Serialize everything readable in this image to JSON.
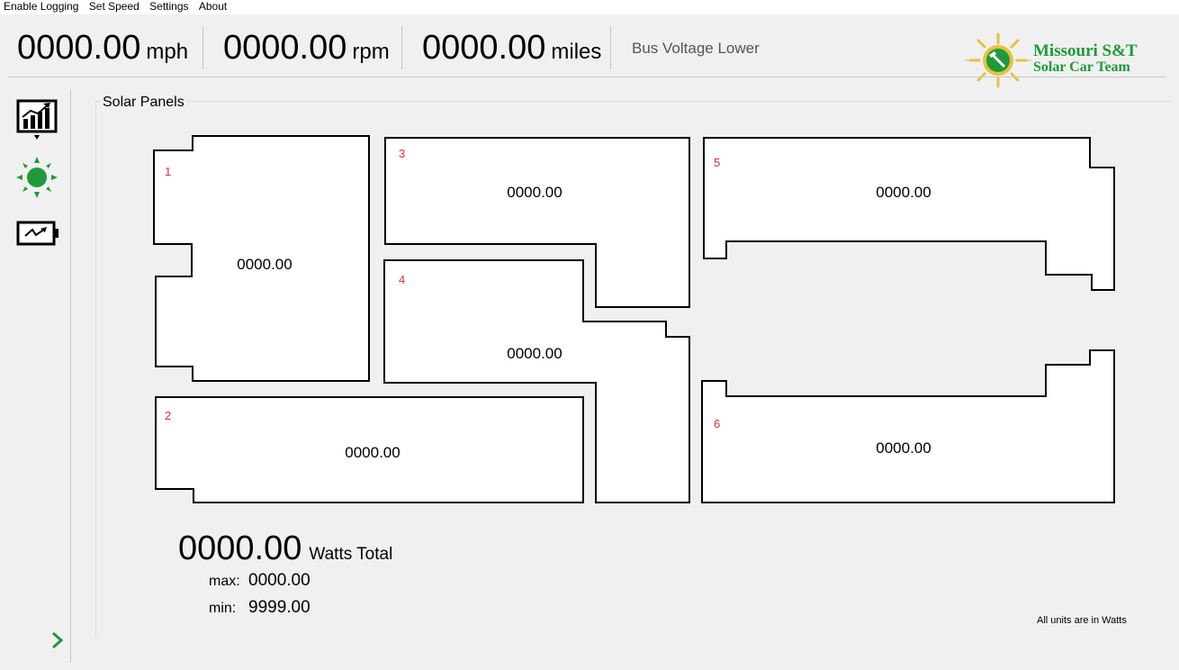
{
  "menu": {
    "items": [
      "Enable Logging",
      "Set Speed",
      "Settings",
      "About"
    ]
  },
  "header": {
    "speed": {
      "value": "0000.00",
      "unit": "mph"
    },
    "rpm": {
      "value": "0000.00",
      "unit": "rpm"
    },
    "distance": {
      "value": "0000.00",
      "unit": "miles"
    },
    "status": "Bus Voltage Lower",
    "logo": {
      "line1": "Missouri S&T",
      "line2": "Solar Car Team"
    }
  },
  "sidebar": {
    "icons": [
      "chart-icon",
      "sun-icon",
      "battery-icon"
    ],
    "expand_icon": "chevron-right-icon"
  },
  "solar": {
    "group_title": "Solar Panels",
    "panels": [
      {
        "id": "1",
        "value": "0000.00"
      },
      {
        "id": "2",
        "value": "0000.00"
      },
      {
        "id": "3",
        "value": "0000.00"
      },
      {
        "id": "4",
        "value": "0000.00"
      },
      {
        "id": "5",
        "value": "0000.00"
      },
      {
        "id": "6",
        "value": "0000.00"
      }
    ],
    "total": {
      "value": "0000.00",
      "unit": "Watts Total"
    },
    "max": {
      "label": "max:",
      "value": "0000.00"
    },
    "min": {
      "label": "min:",
      "value": "9999.00"
    },
    "units_note": "All units are in Watts"
  },
  "colors": {
    "accent_green": "#1f9a3a",
    "panel_number_red": "#e03030",
    "logo_gold": "#e8c040"
  }
}
